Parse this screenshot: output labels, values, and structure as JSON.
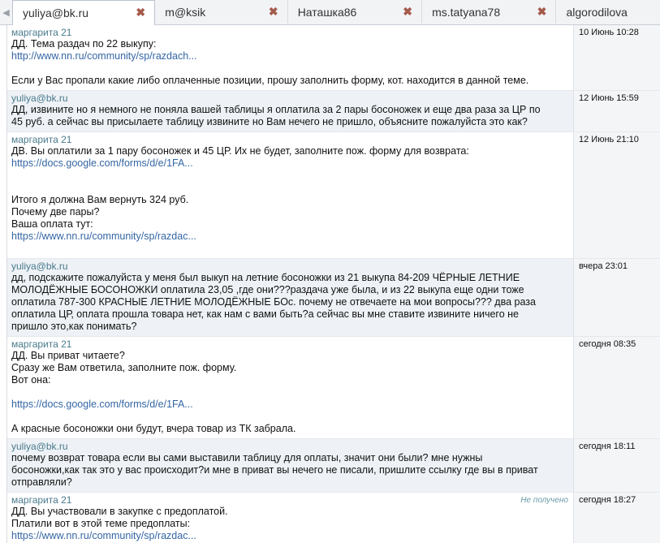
{
  "tabs": [
    {
      "label": "yuliya@bk.ru",
      "active": true
    },
    {
      "label": "m@ksik",
      "active": false
    },
    {
      "label": "Наташка86",
      "active": false
    },
    {
      "label": "ms.tatyana78",
      "active": false
    },
    {
      "label": "algorodilova",
      "active": false
    }
  ],
  "messages": [
    {
      "author": "маргарита 21",
      "date": "10 Июнь 10:28",
      "lines": [
        {
          "text": "ДД. Тема раздач по 22 выкупу:"
        },
        {
          "text": "http://www.nn.ru/community/sp/razdach...",
          "link": true
        },
        {
          "text": ""
        },
        {
          "text": "Если у Вас пропали какие либо оплаченные позиции, прошу заполнить форму, кот. находится в данной теме."
        }
      ]
    },
    {
      "author": "yuliya@bk.ru",
      "date": "12 Июнь 15:59",
      "lines": [
        {
          "text": "ДД, извините но я немного не поняла вашей таблицы я оплатила за 2 пары босоножек и еще два раза за ЦР по"
        },
        {
          "text": "45 руб. а сейчас вы присылаете таблицу извините но Вам нечего не пришло, объясните пожалуйста это как?"
        }
      ]
    },
    {
      "author": "маргарита 21",
      "date": "12 Июнь 21:10",
      "lines": [
        {
          "text": "ДВ. Вы оплатили за 1 пару босоножек и 45 ЦР. Их не будет, заполните пож. форму для возврата:"
        },
        {
          "text": "https://docs.google.com/forms/d/e/1FA...",
          "link": true
        },
        {
          "text": ""
        },
        {
          "text": ""
        },
        {
          "text": "Итого я должна Вам вернуть 324 руб."
        },
        {
          "text": "Почему две пары?"
        },
        {
          "text": "Ваша оплата тут:"
        },
        {
          "text": "https://www.nn.ru/community/sp/razdac...",
          "link": true
        },
        {
          "text": ""
        }
      ]
    },
    {
      "author": "yuliya@bk.ru",
      "date": "вчера 23:01",
      "lines": [
        {
          "text": "дд, подскажите пожалуйста у меня был выкуп на летние босоножки из 21 выкупа 84-209 ЧЁРНЫЕ ЛЕТНИЕ"
        },
        {
          "text": "МОЛОДЁЖНЫЕ БОСОНОЖКИ оплатила 23,05 ,где они???раздача уже была, и из 22 выкупа еще одни тоже"
        },
        {
          "text": "оплатила 787-300 КРАСНЫЕ ЛЕТНИЕ МОЛОДЁЖНЫЕ БОс. почему не отвечаете на мои вопросы??? два раза"
        },
        {
          "text": "оплатила ЦР, оплата прошла товара нет, как нам с вами быть?а сейчас вы мне ставите извините ничего не"
        },
        {
          "text": "пришло это,как понимать?"
        }
      ]
    },
    {
      "author": "маргарита 21",
      "date": "сегодня 08:35",
      "lines": [
        {
          "text": "ДД. Вы приват читаете?"
        },
        {
          "text": "Сразу же Вам ответила, заполните пож. форму."
        },
        {
          "text": "Вот она:"
        },
        {
          "text": ""
        },
        {
          "text": "https://docs.google.com/forms/d/e/1FA...",
          "link": true
        },
        {
          "text": ""
        },
        {
          "text": "А красные босоножки они будут, вчера товар из ТК забрала."
        }
      ]
    },
    {
      "author": "yuliya@bk.ru",
      "date": "сегодня 18:11",
      "lines": [
        {
          "text": "почему возврат товара если вы сами выставили таблицу для оплаты, значит они были? мне нужны"
        },
        {
          "text": "босоножки,как так это у вас происходит?и мне в приват вы нечего не писали, пришлите ссылку где вы в приват"
        },
        {
          "text": "отправляли?"
        }
      ]
    },
    {
      "author": "маргарита 21",
      "date": "сегодня 18:27",
      "status": "Не получено",
      "lines": [
        {
          "text": "ДД. Вы участвовали в закупке с предоплатой."
        },
        {
          "text": "Платили вот в этой теме предоплаты:"
        },
        {
          "text": "https://www.nn.ru/community/sp/razdac...",
          "link": true
        }
      ]
    }
  ]
}
